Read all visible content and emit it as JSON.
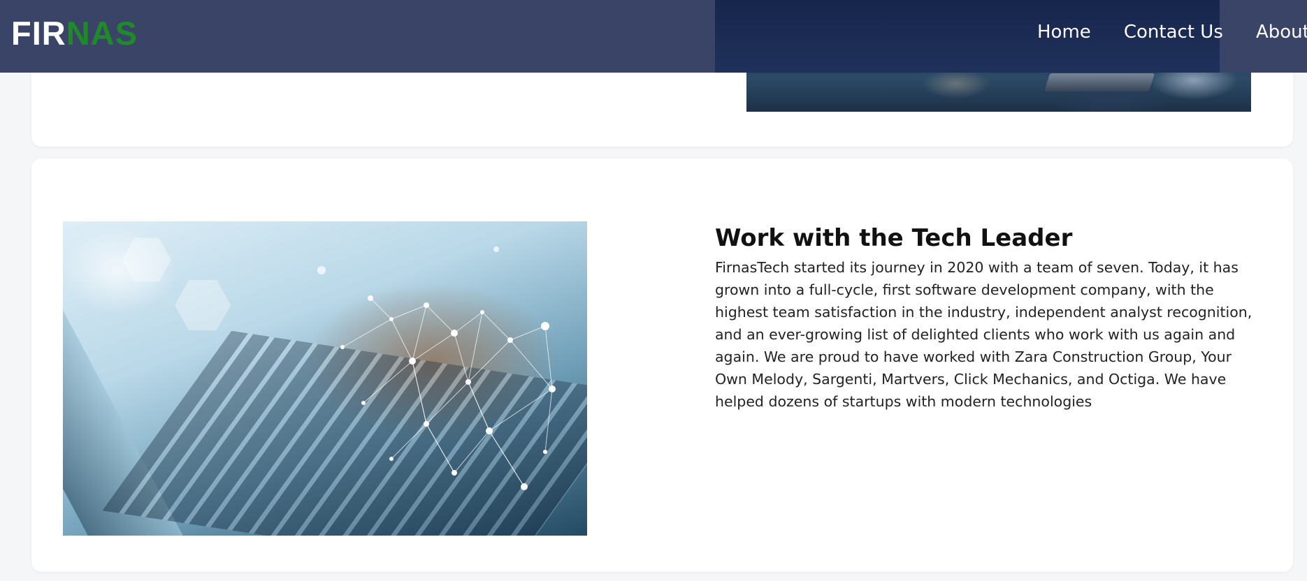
{
  "nav": {
    "logo_part1": "FIR",
    "logo_part2": "NAS",
    "links": [
      "Home",
      "Contact Us",
      "About U"
    ]
  },
  "colors": {
    "navbar": "#3a4466",
    "logo_primary": "#ffffff",
    "logo_accent": "#1f8a2a",
    "card": "#ffffff",
    "page": "#f5f6f8"
  },
  "section": {
    "title": "Work with the Tech Leader",
    "body": "FirnasTech started its journey in 2020 with a team of seven. Today, it has grown into a full-cycle, first software development company, with the highest team satisfaction in the industry, independent analyst recognition, and an ever-growing list of delighted clients who work with us again and again. We are proud to have worked with Zara Construction Group, Your Own Melody, Sargenti, Martvers, Click Mechanics, and Octiga. We have helped dozens of startups with modern technologies"
  }
}
